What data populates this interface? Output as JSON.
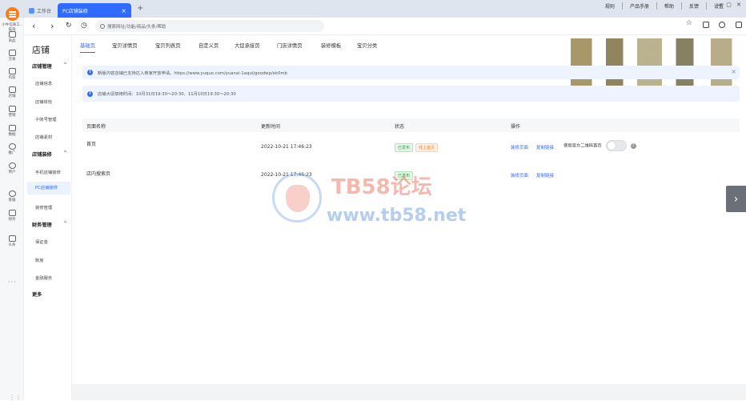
{
  "window": {
    "tabs": [
      {
        "label": "工作台"
      },
      {
        "label": "PC店铺装修",
        "close": "×"
      }
    ],
    "new_tab": "+",
    "top_menu": [
      "规则",
      "产品手册",
      "帮助",
      "反馈",
      "设置"
    ],
    "window_controls": "— ▢ ✕"
  },
  "address": {
    "placeholder": "搜索网址/功能/商品/头条/帮助"
  },
  "rail": {
    "brand": "小牛信商工.. 猫淘",
    "items": [
      "商品",
      "交易",
      "内容",
      "店铺",
      "营销",
      "数据",
      "推广",
      "用户",
      "客服",
      "财务",
      "头条"
    ]
  },
  "subnav": {
    "title": "店铺",
    "groups": [
      {
        "label": "店铺管理",
        "caret": "^",
        "items": [
          "店铺信息",
          "店铺体检",
          "子账号管理",
          "店铺素材"
        ]
      },
      {
        "label": "店铺装修",
        "caret": "^",
        "items": [
          "手机店铺装修",
          "PC店铺装修",
          "装修管理"
        ]
      },
      {
        "label": "财务管理",
        "caret": "^",
        "items": [
          "保证金",
          "账房",
          "金融服务"
        ]
      }
    ],
    "more": "更多"
  },
  "page_tabs": [
    "基础页",
    "宝贝详情页",
    "宝贝列表页",
    "自定义页",
    "大促承接页",
    "门店详情页",
    "装修模板",
    "宝贝分类"
  ],
  "notices": [
    {
      "text": "新版内容店铺已支持达入商家开放申请。https://www.yuque.com/yuanxi-1aqui/goodwp/ek0mb",
      "close": "×"
    },
    {
      "text": "店铺大促禁用时间：10月31日19:30～20:30、11月10日19:30～20:30"
    }
  ],
  "table": {
    "headers": [
      "页面名称",
      "更新时间",
      "状态",
      "操作"
    ],
    "rows": [
      {
        "name": "首页",
        "time": "2022-10-21 17:46:23",
        "status": [
          "已发布",
          "线上首页"
        ],
        "actions": [
          "装修页面",
          "复制链接"
        ],
        "qr_label": "使用官方二维码首页",
        "help": "?"
      },
      {
        "name": "店内搜索页",
        "time": "2022-10-21 17:46:23",
        "status": [
          "已发布"
        ],
        "actions": [
          "装修页面",
          "复制链接"
        ]
      }
    ]
  },
  "watermark": {
    "title": "TB58论坛",
    "url": "www.tb58.net"
  },
  "side_arrow": "›",
  "colors": {
    "accent": "#2f6bff",
    "brand_orange": "#ff7a1a",
    "published_green": "#2aa43a"
  }
}
